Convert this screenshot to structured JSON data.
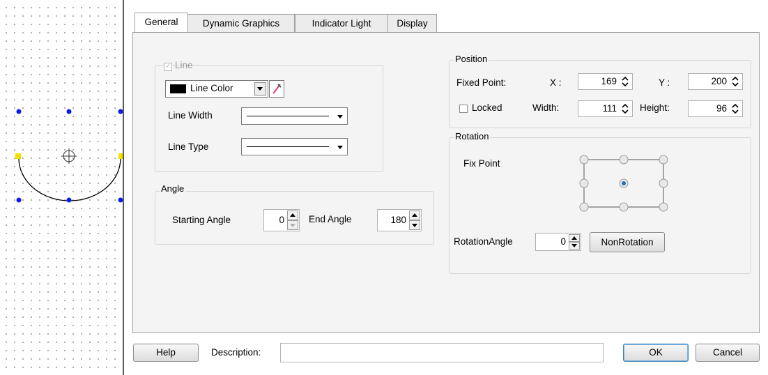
{
  "tabs": [
    "General",
    "Dynamic Graphics",
    "Indicator Light",
    "Display"
  ],
  "line_group": {
    "checkbox_label": "Line",
    "line_color_label": "Line Color",
    "line_color_value": "#000000",
    "line_width_label": "Line Width",
    "line_type_label": "Line Type"
  },
  "angle_group": {
    "title": "Angle",
    "starting_label": "Starting Angle",
    "starting_value": "0",
    "end_label": "End Angle",
    "end_value": "180"
  },
  "position_group": {
    "title": "Position",
    "fixed_point_label": "Fixed Point:",
    "x_label": "X :",
    "x_value": "169",
    "y_label": "Y :",
    "y_value": "200",
    "locked_label": "Locked",
    "width_label": "Width:",
    "width_value": "111",
    "height_label": "Height:",
    "height_value": "96"
  },
  "rotation_group": {
    "title": "Rotation",
    "fix_point_label": "Fix Point",
    "rotation_angle_label": "RotationAngle",
    "rotation_angle_value": "0",
    "non_rotation_label": "NonRotation"
  },
  "footer": {
    "help_label": "Help",
    "description_label": "Description:",
    "description_value": "",
    "ok_label": "OK",
    "cancel_label": "Cancel"
  },
  "colors": {
    "handle_blue": "#0a1de6",
    "handle_yellow": "#f0e000",
    "panel_bg": "#f4f4f4",
    "focus_border": "#3c7fb1"
  },
  "icons": [
    "eyedropper-icon",
    "spin-up-down-icon",
    "dropdown-arrow-icon",
    "crosshair-icon"
  ]
}
